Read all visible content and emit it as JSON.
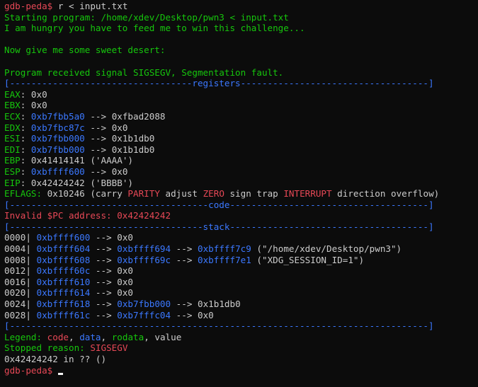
{
  "terminal": {
    "prompt": "gdb-peda$",
    "command": " r < input.txt",
    "starting_program": "Starting program: /home/xdev/Desktop/pwn3 < input.txt",
    "hungry": "I am hungry you have to feed me to win this challenge...",
    "sweet": "Now give me some sweet desert:",
    "signal": "Program received signal SIGSEGV, Segmentation fault.",
    "sep_registers": "[----------------------------------registers-----------------------------------]",
    "registers": [
      {
        "name": "EAX",
        "val": "0x0",
        "arrow": "",
        "target": "",
        "extra": ""
      },
      {
        "name": "EBX",
        "val": "0x0",
        "arrow": "",
        "target": "",
        "extra": ""
      },
      {
        "name": "ECX",
        "val": "0xb7fbb5a0",
        "arrow": "-->",
        "target": "0xfbad2088",
        "extra": ""
      },
      {
        "name": "EDX",
        "val": "0xb7fbc87c",
        "arrow": "-->",
        "target": "0x0",
        "extra": ""
      },
      {
        "name": "ESI",
        "val": "0xb7fbb000",
        "arrow": "-->",
        "target": "0x1b1db0",
        "extra": ""
      },
      {
        "name": "EDI",
        "val": "0xb7fbb000",
        "arrow": "-->",
        "target": "0x1b1db0",
        "extra": ""
      },
      {
        "name": "EBP",
        "val": "0x41414141",
        "arrow": "",
        "target": "",
        "extra": "('AAAA')"
      },
      {
        "name": "ESP",
        "val": "0xbffff600",
        "arrow": "-->",
        "target": "0x0",
        "extra": ""
      },
      {
        "name": "EIP",
        "val": "0x42424242",
        "arrow": "",
        "target": "",
        "extra": "('BBBB')"
      }
    ],
    "eflags_label": "EFLAGS: ",
    "eflags_value": "0x10246",
    "eflags_open": " (carry ",
    "flag_parity": "PARITY",
    "flag_adjust": " adjust ",
    "flag_zero": "ZERO",
    "flag_sign_trap": " sign trap ",
    "flag_interrupt": "INTERRUPT",
    "flag_tail": " direction overflow)",
    "sep_code": "[-------------------------------------code-------------------------------------]",
    "invalid_pc": "Invalid $PC address: 0x42424242",
    "sep_stack": "[------------------------------------stack-------------------------------------]",
    "stack": [
      {
        "offset": "0000|",
        "addr": "0xbffff600",
        "chain": [
          {
            "t": " --> ",
            "c": "w"
          },
          {
            "t": "0x0",
            "c": "w"
          }
        ]
      },
      {
        "offset": "0004|",
        "addr": "0xbffff604",
        "chain": [
          {
            "t": " --> ",
            "c": "w"
          },
          {
            "t": "0xbffff694",
            "c": "b"
          },
          {
            "t": " --> ",
            "c": "w"
          },
          {
            "t": "0xbffff7c9",
            "c": "b"
          },
          {
            "t": " (\"/home/xdev/Desktop/pwn3\")",
            "c": "w"
          }
        ]
      },
      {
        "offset": "0008|",
        "addr": "0xbffff608",
        "chain": [
          {
            "t": " --> ",
            "c": "w"
          },
          {
            "t": "0xbffff69c",
            "c": "b"
          },
          {
            "t": " --> ",
            "c": "w"
          },
          {
            "t": "0xbffff7e1",
            "c": "b"
          },
          {
            "t": " (\"XDG_SESSION_ID=1\")",
            "c": "w"
          }
        ]
      },
      {
        "offset": "0012|",
        "addr": "0xbffff60c",
        "chain": [
          {
            "t": " --> ",
            "c": "w"
          },
          {
            "t": "0x0",
            "c": "w"
          }
        ]
      },
      {
        "offset": "0016|",
        "addr": "0xbffff610",
        "chain": [
          {
            "t": " --> ",
            "c": "w"
          },
          {
            "t": "0x0",
            "c": "w"
          }
        ]
      },
      {
        "offset": "0020|",
        "addr": "0xbffff614",
        "chain": [
          {
            "t": " --> ",
            "c": "w"
          },
          {
            "t": "0x0",
            "c": "w"
          }
        ]
      },
      {
        "offset": "0024|",
        "addr": "0xbffff618",
        "chain": [
          {
            "t": " --> ",
            "c": "w"
          },
          {
            "t": "0xb7fbb000",
            "c": "b"
          },
          {
            "t": " --> ",
            "c": "w"
          },
          {
            "t": "0x1b1db0",
            "c": "w"
          }
        ]
      },
      {
        "offset": "0028|",
        "addr": "0xbffff61c",
        "chain": [
          {
            "t": " --> ",
            "c": "w"
          },
          {
            "t": "0xb7fffc04",
            "c": "b"
          },
          {
            "t": " --> ",
            "c": "w"
          },
          {
            "t": "0x0",
            "c": "w"
          }
        ]
      }
    ],
    "sep_end": "[------------------------------------------------------------------------------]",
    "legend_label": "Legend: ",
    "legend_code": "code",
    "legend_comma1": ", ",
    "legend_data": "data",
    "legend_comma2": ", ",
    "legend_rodata": "rodata",
    "legend_comma3": ", ",
    "legend_value": "value",
    "stopped_label": "Stopped reason: ",
    "stopped_value": "SIGSEGV",
    "location": "0x42424242 in ?? ()",
    "prompt2": "gdb-peda$",
    "input": " "
  },
  "colors": {
    "background": "#0c0c0c",
    "text": "#cccccc",
    "green": "#13a10e",
    "blue": "#3b78ff",
    "red": "#e74856"
  }
}
